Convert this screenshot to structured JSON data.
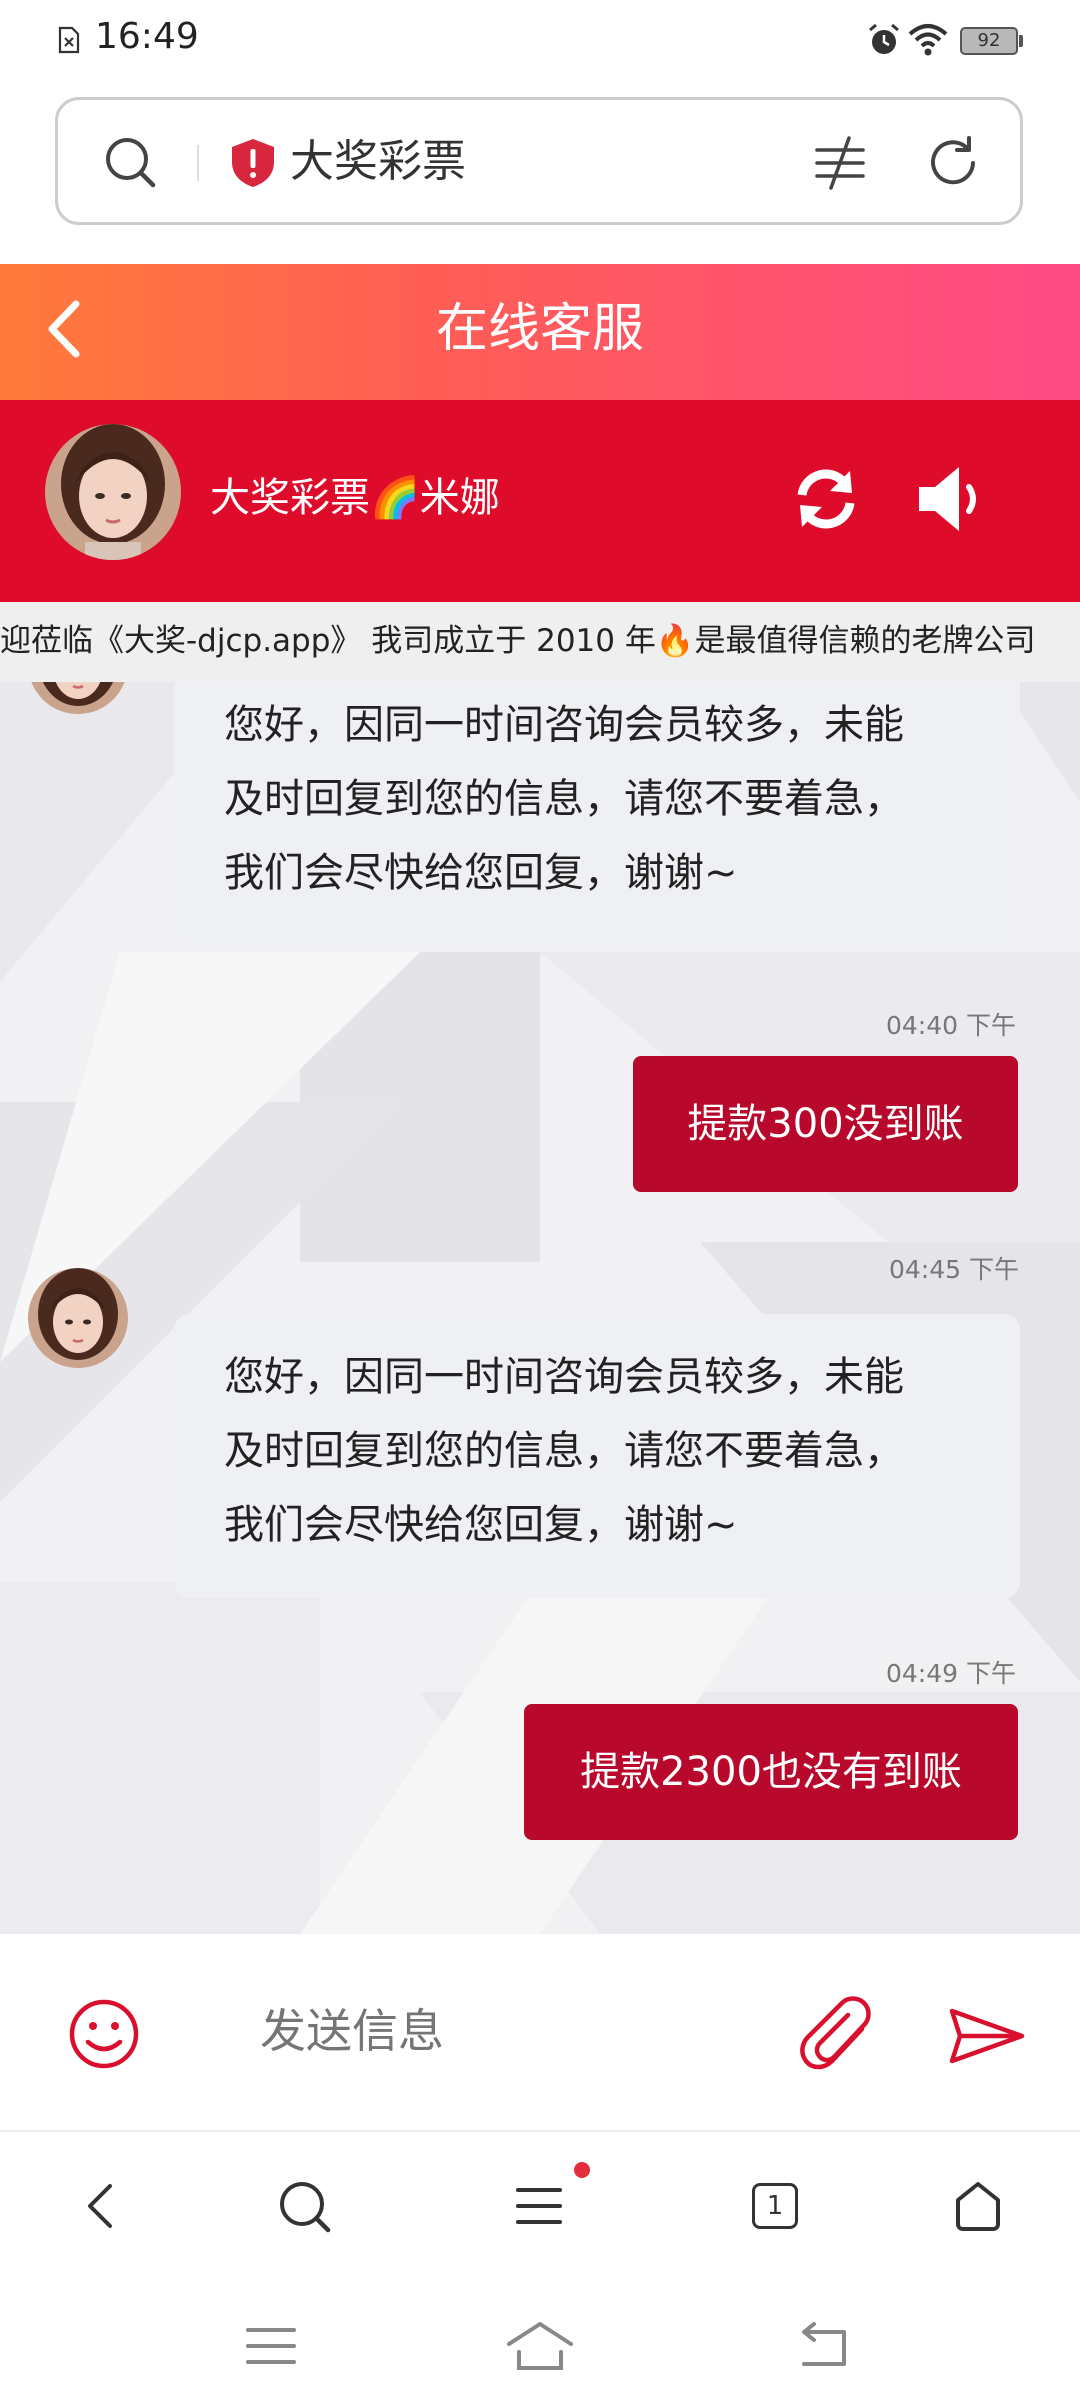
{
  "status_bar": {
    "time": "16:49",
    "battery": "92"
  },
  "url_bar": {
    "title": "大奖彩票"
  },
  "chat_header": {
    "title": "在线客服"
  },
  "agent": {
    "name": "大奖彩票🌈米娜"
  },
  "marquee": {
    "text": "迎莅临《大奖-djcp.app》 我司成立于 2010 年🔥是最值得信赖的老牌公司"
  },
  "messages": [
    {
      "type": "incoming",
      "lines": [
        "您好，因同一时间咨询会员较多，未能",
        "及时回复到您的信息，请您不要着急，",
        "我们会尽快给您回复，谢谢~"
      ]
    },
    {
      "type": "outgoing",
      "time": "04:40 下午",
      "text": "提款300没到账"
    },
    {
      "type": "time",
      "time": "04:45 下午"
    },
    {
      "type": "incoming",
      "lines": [
        "您好，因同一时间咨询会员较多，未能",
        "及时回复到您的信息，请您不要着急，",
        "我们会尽快给您回复，谢谢~"
      ]
    },
    {
      "type": "outgoing",
      "time": "04:49 下午",
      "text": "提款2300也没有到账"
    }
  ],
  "composer": {
    "placeholder": "发送信息"
  },
  "browser_nav": {
    "tab_count": "1"
  },
  "colors": {
    "header_gradient_start": "#ff7a3a",
    "header_gradient_end": "#ff4a86",
    "agent_bar": "#df0b2a",
    "outgoing_bubble": "#b8082c",
    "icon_red": "#d8102e",
    "shield_red": "#d7263d"
  },
  "icons": [
    "search-icon",
    "shield-icon",
    "filter-icon",
    "reload-icon",
    "back-chevron-icon",
    "refresh-icon",
    "speaker-icon",
    "emoji-icon",
    "attach-icon",
    "send-icon",
    "tabs-icon",
    "home-icon",
    "menu-icon"
  ]
}
